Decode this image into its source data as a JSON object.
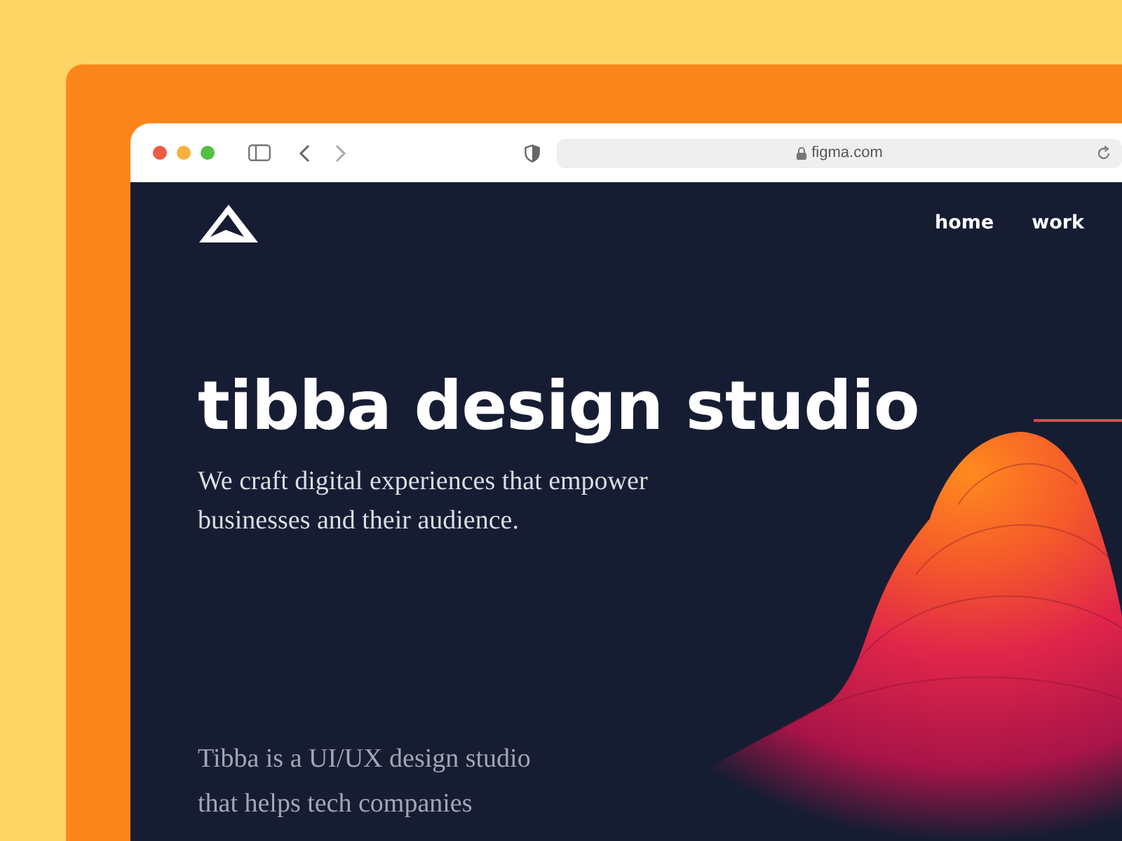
{
  "browser": {
    "url": "figma.com"
  },
  "site": {
    "nav": [
      {
        "label": "home"
      },
      {
        "label": "work"
      }
    ],
    "title": "tibba design studio",
    "tagline": "We craft digital experiences that empower businesses and their audience.",
    "intro": "Tibba is a UI/UX design studio that helps tech companies"
  }
}
